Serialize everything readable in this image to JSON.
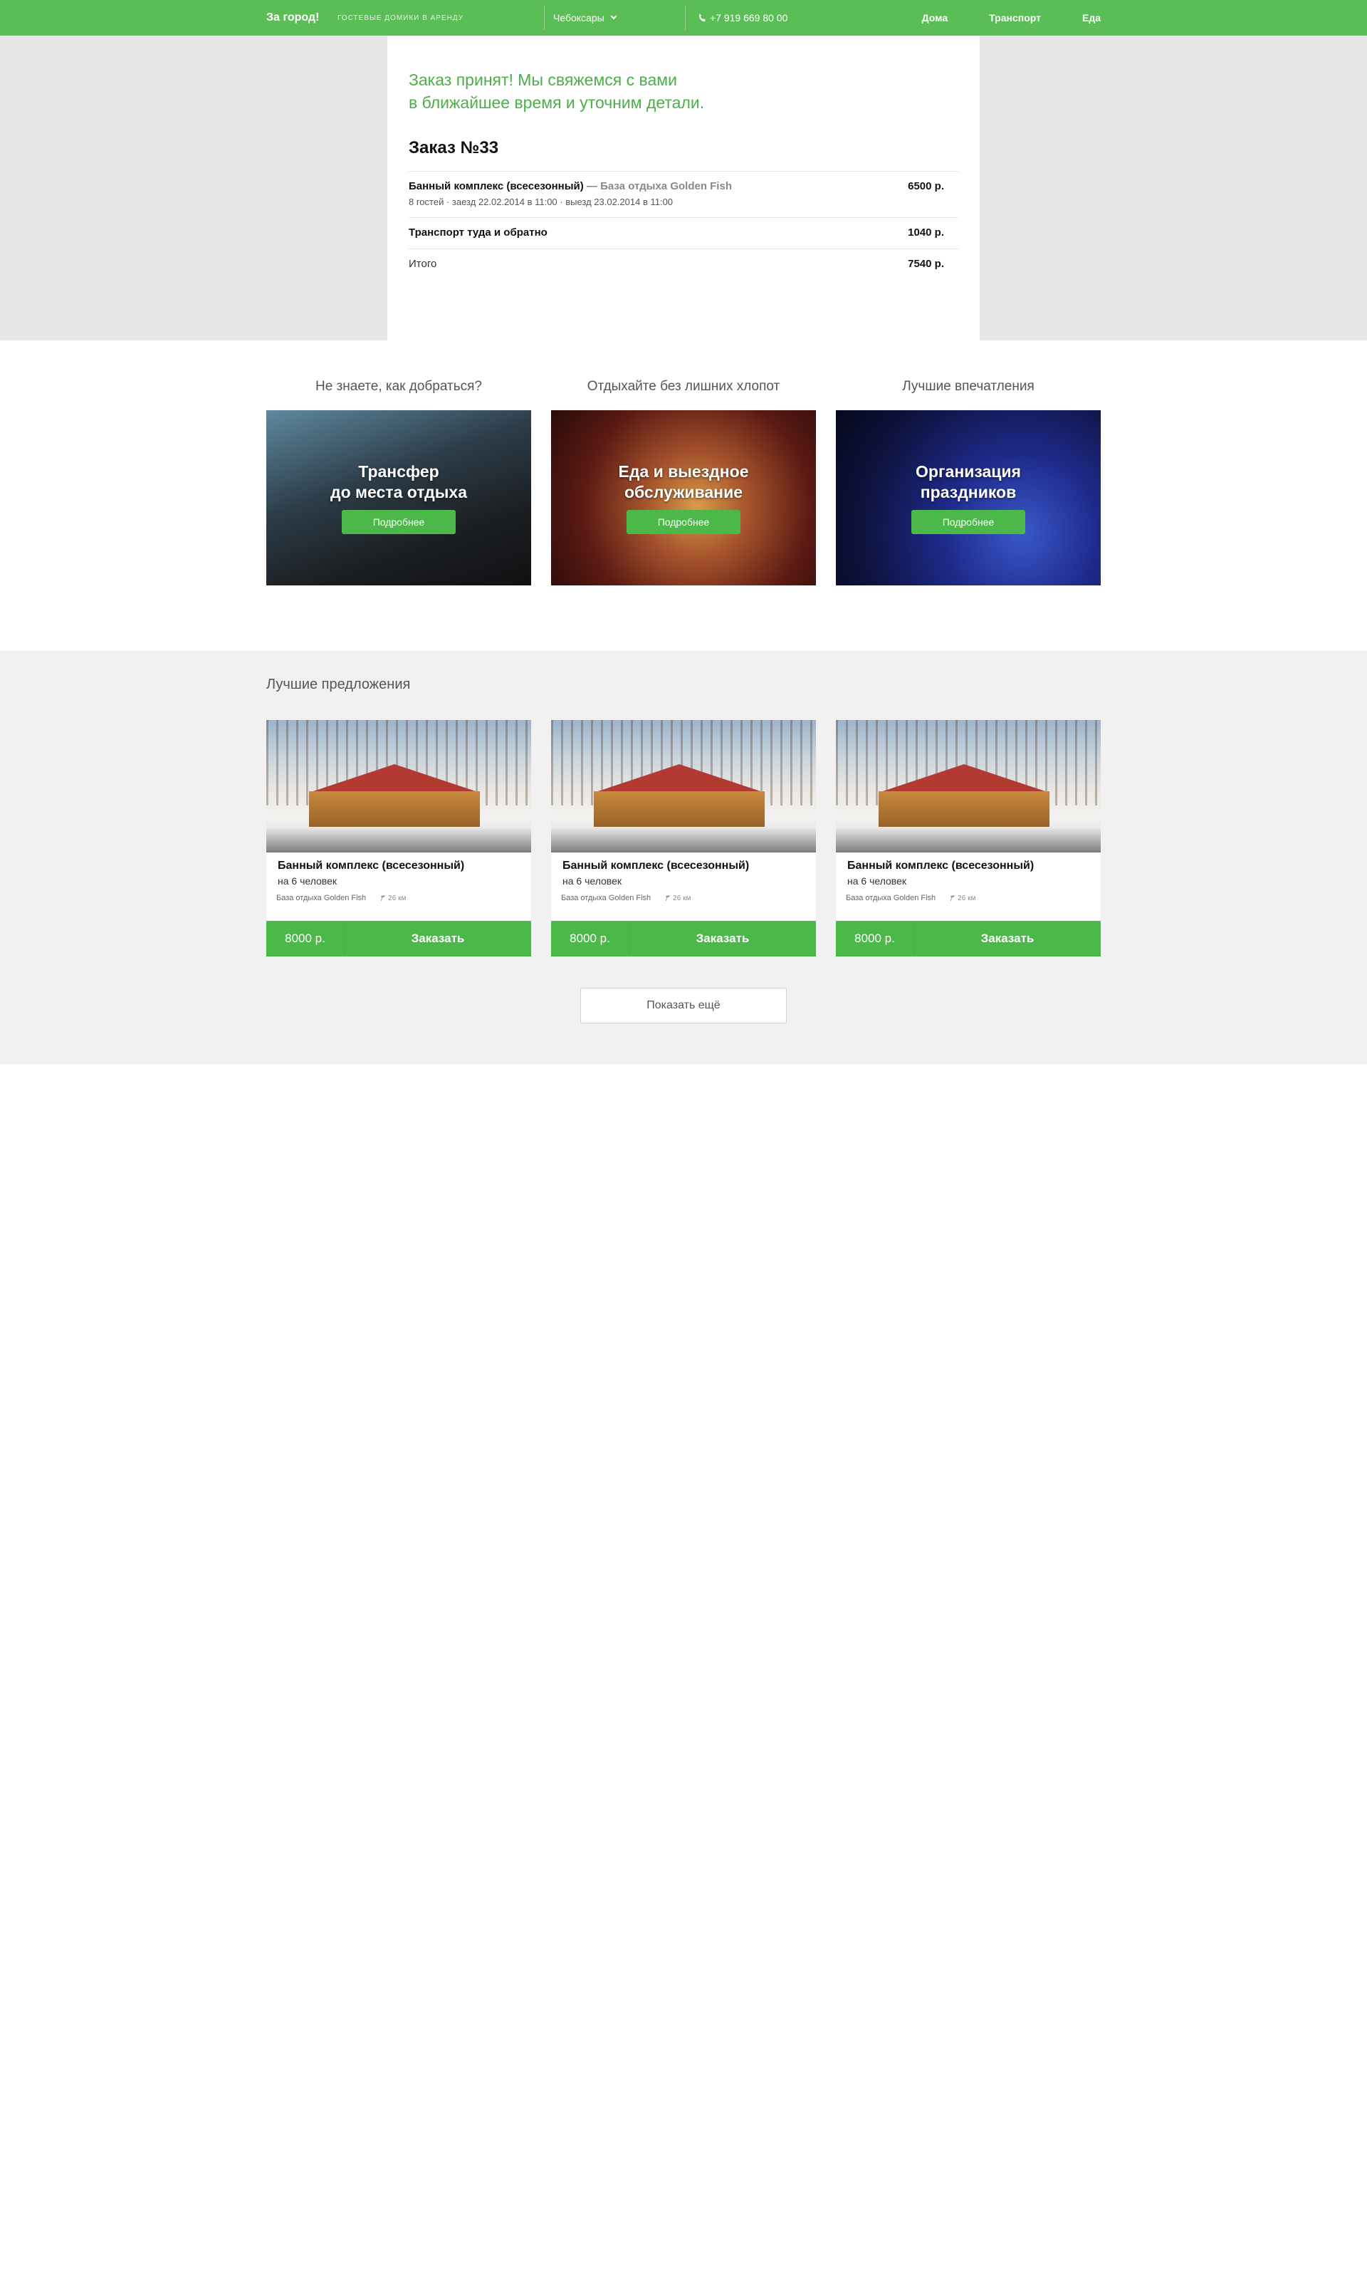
{
  "header": {
    "logo": "За город!",
    "tagline": "ГОСТЕВЫЕ ДОМИКИ В АРЕНДУ",
    "city": "Чебоксары",
    "phone": "+7 919 669 80 00",
    "nav": [
      "Дома",
      "Транспорт",
      "Еда"
    ],
    "background": "#5bbd55"
  },
  "order": {
    "confirmation": "Заказ принят! Мы свяжемся с вами\nв ближайшее время и уточним детали.",
    "title": "Заказ №33",
    "item_name": "Банный комплекс (всесезонный)",
    "item_place": "— База отдыха Golden Fish",
    "item_details": "8 гостей · заезд 22.02.2014 в 11:00 · выезд 23.02.2014 в 11:00",
    "item_price": "6500 р.",
    "transport_label": "Транспорт туда и обратно",
    "transport_price": "1040 р.",
    "total_label": "Итого",
    "total_price": "7540 р."
  },
  "services": [
    {
      "question": "Не знаете, как добраться?",
      "title": "Трансфер\nдо места отдыха",
      "button": "Подробнее"
    },
    {
      "question": "Отдыхайте без лишних хлопот",
      "title": "Еда и выездное\nобслуживание",
      "button": "Подробнее"
    },
    {
      "question": "Лучшие впечатления",
      "title": "Организация\nпраздников",
      "button": "Подробнее"
    }
  ],
  "offers": {
    "title": "Лучшие предложения",
    "items": [
      {
        "name": "Банный комплекс (всесезонный)",
        "capacity": "на 6 человек",
        "place": "База отдыха Golden Fish",
        "distance": "26 км",
        "price": "8000 р.",
        "button": "Заказать"
      },
      {
        "name": "Банный комплекс (всесезонный)",
        "capacity": "на 6 человек",
        "place": "База отдыха Golden Fish",
        "distance": "26 км",
        "price": "8000 р.",
        "button": "Заказать"
      },
      {
        "name": "Банный комплекс (всесезонный)",
        "capacity": "на 6 человек",
        "place": "База отдыха Golden Fish",
        "distance": "26 км",
        "price": "8000 р.",
        "button": "Заказать"
      }
    ],
    "show_more": "Показать ещё"
  },
  "colors": {
    "accent": "#4cb84a",
    "header": "#5bbd55",
    "confirm_text": "#4caf4a"
  },
  "icons": [
    "chevron-down-icon",
    "phone-icon",
    "pin-icon"
  ]
}
